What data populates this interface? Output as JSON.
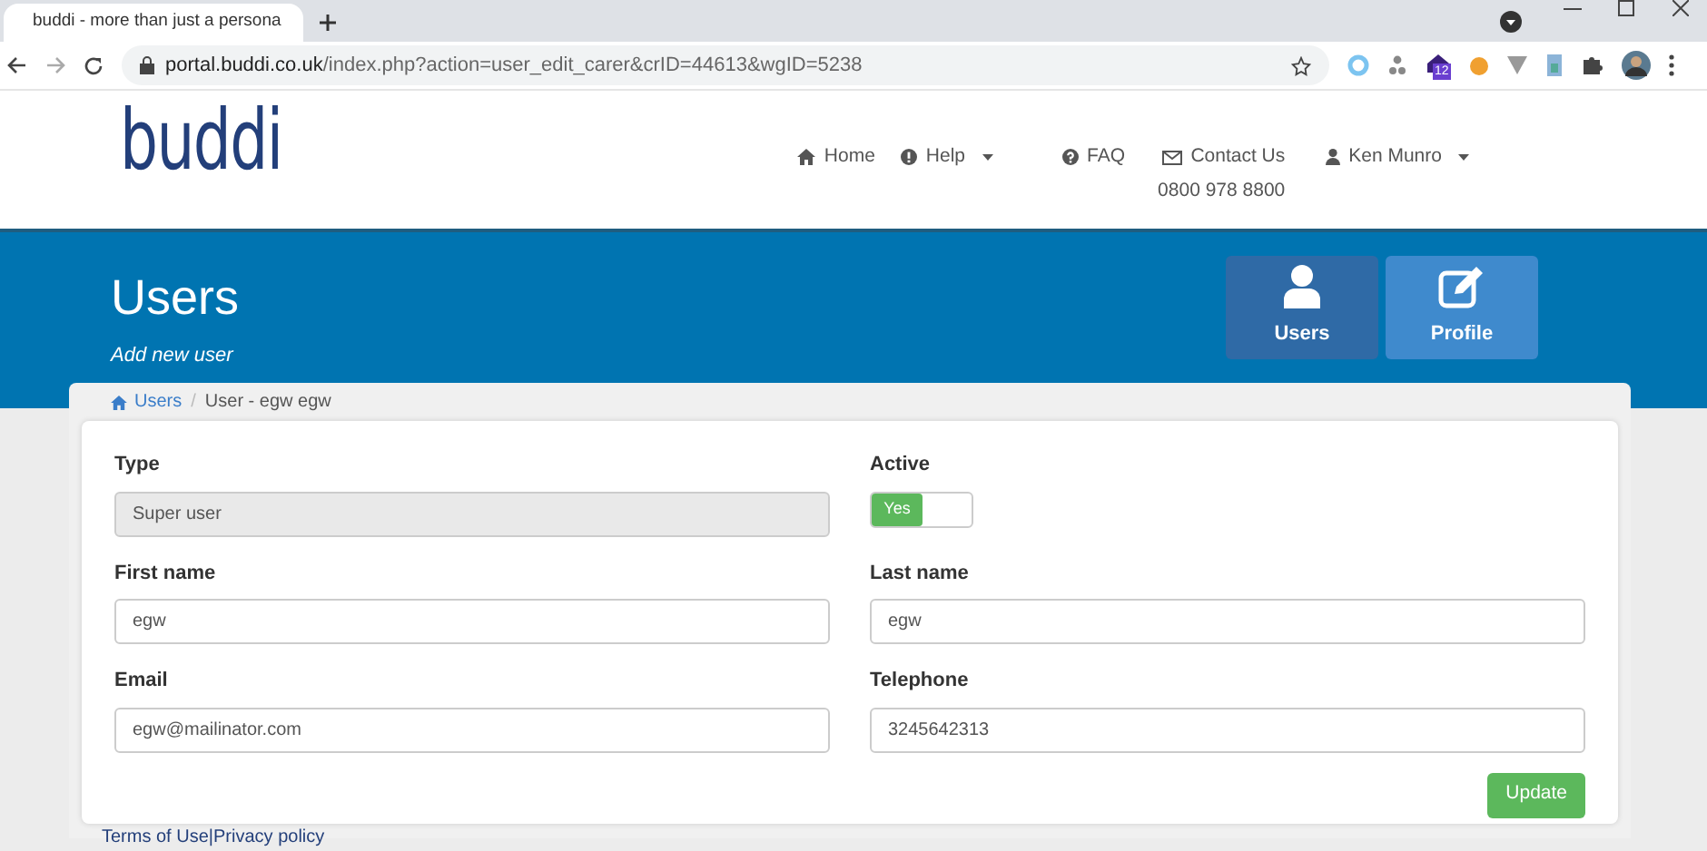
{
  "browser": {
    "tab_title": "buddi - more than just a persona",
    "url_host": "portal.buddi.co.uk",
    "url_path": "/index.php?action=user_edit_carer&crID=44613&wgID=5238",
    "extension_badge": "12"
  },
  "header": {
    "logo": "buddi",
    "nav": [
      {
        "kind": "home",
        "label": "Home",
        "dropdown": false
      },
      {
        "kind": "help",
        "label": "Help",
        "dropdown": true
      },
      {
        "kind": "faq",
        "label": "FAQ",
        "dropdown": false
      },
      {
        "kind": "contact",
        "label": "Contact Us",
        "sub": "0800 978 8800",
        "dropdown": false
      },
      {
        "kind": "user",
        "label": "Ken Munro",
        "dropdown": true
      }
    ]
  },
  "banner": {
    "title": "Users",
    "subtitle": "Add new user",
    "tiles": [
      {
        "kind": "user",
        "label": "Users",
        "selected": false
      },
      {
        "kind": "edit",
        "label": "Profile",
        "selected": true
      }
    ]
  },
  "breadcrumb_separator": "/",
  "breadcrumb": [
    {
      "label": "Users",
      "link": true
    },
    {
      "label": "User - egw egw",
      "link": false
    }
  ],
  "form": {
    "fields": [
      {
        "kind": "readonly",
        "label": "Type",
        "value": "Super user"
      },
      {
        "kind": "toggle",
        "label": "Active",
        "text": "Yes",
        "on": true
      },
      {
        "kind": "input",
        "label": "First name",
        "value": "egw"
      },
      {
        "kind": "input",
        "label": "Last name",
        "value": "egw"
      },
      {
        "kind": "input",
        "label": "Email",
        "value": "egw@mailinator.com"
      },
      {
        "kind": "input",
        "label": "Telephone",
        "value": "3245642313"
      }
    ],
    "submit": "Update"
  },
  "footer": {
    "links": [
      "Terms of Use",
      "Privacy policy"
    ],
    "separator": "|"
  }
}
